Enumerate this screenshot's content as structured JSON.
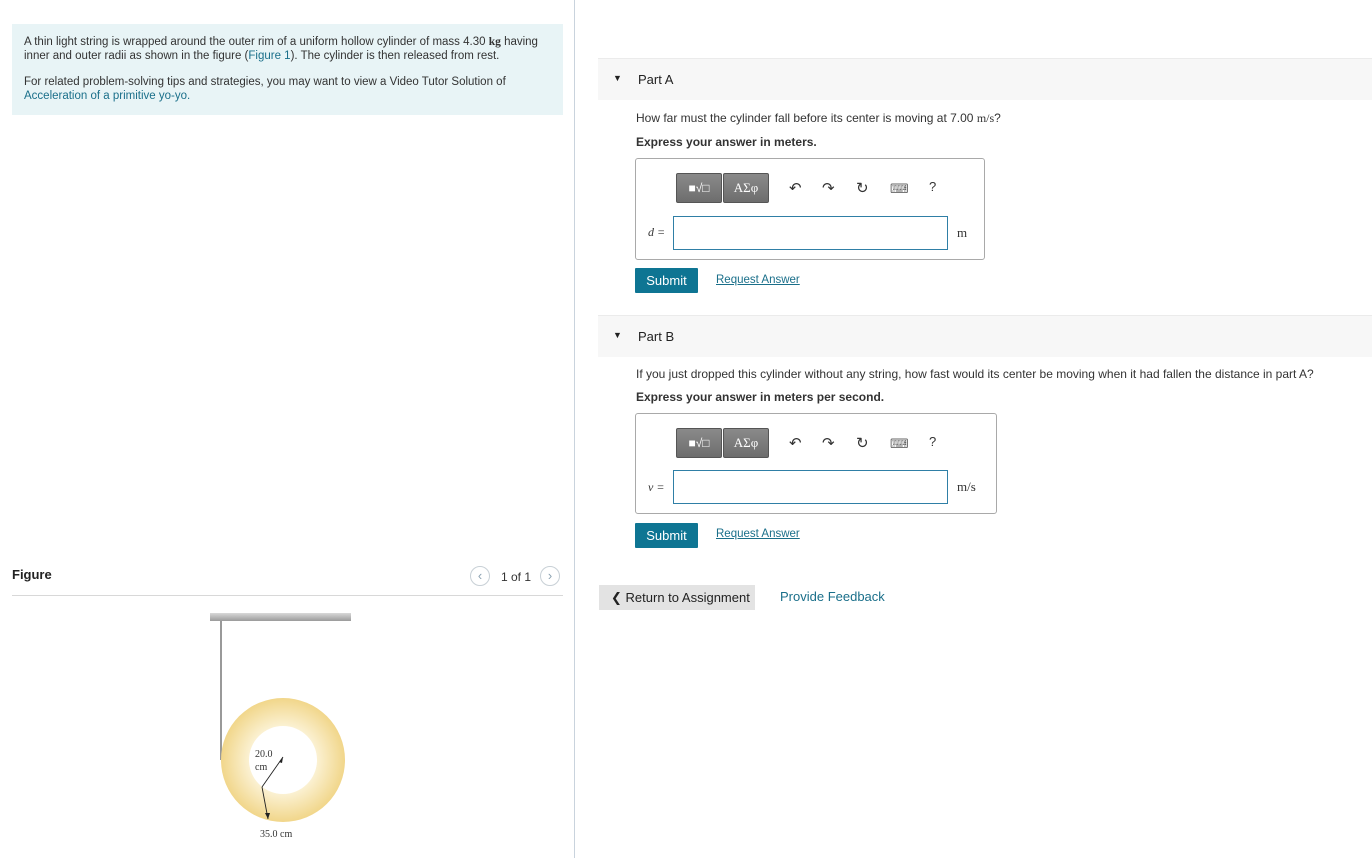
{
  "intro": {
    "text1": "A thin light string is wrapped around the outer rim of a uniform hollow cylinder of mass 4.30 ",
    "mass_unit": "kg",
    "text2": " having inner and outer radii as shown in the figure (",
    "figure_link": "Figure 1",
    "text3": "). The cylinder is then released from rest.",
    "tips": "For related problem-solving tips and strategies, you may want to view a Video Tutor Solution of ",
    "video_link": "Acceleration of a primitive yo-yo."
  },
  "figure": {
    "title": "Figure",
    "count": "1 of 1",
    "inner_label_value": "20.0",
    "inner_label_unit": "cm",
    "outer_label": "35.0 cm"
  },
  "partA": {
    "title": "Part A",
    "question_pre": "How far must the cylinder fall before its center is moving at 7.00 ",
    "question_unit": "m/s",
    "question_post": "?",
    "instruction": "Express your answer in meters.",
    "var": "d =",
    "unit": "m",
    "input_value": "",
    "submit": "Submit",
    "request": "Request Answer"
  },
  "partB": {
    "title": "Part B",
    "question": "If you just dropped this cylinder without any string, how fast would its center be moving when it had fallen the distance in part A?",
    "instruction": "Express your answer in meters per second.",
    "var": "v =",
    "unit": "m/s",
    "input_value": "",
    "submit": "Submit",
    "request": "Request Answer"
  },
  "toolbar": {
    "greek": "ΑΣφ",
    "help": "?",
    "icons": [
      "templates-icon",
      "greek-symbols-icon",
      "undo-icon",
      "redo-icon",
      "reset-icon",
      "keyboard-icon",
      "help-icon"
    ]
  },
  "nav": {
    "return": "Return to Assignment",
    "feedback": "Provide Feedback"
  },
  "colors": {
    "accent": "#0e7593",
    "link": "#1a6f8a",
    "intro_bg": "#e8f4f6",
    "cylinder": "#f5dc8f"
  }
}
